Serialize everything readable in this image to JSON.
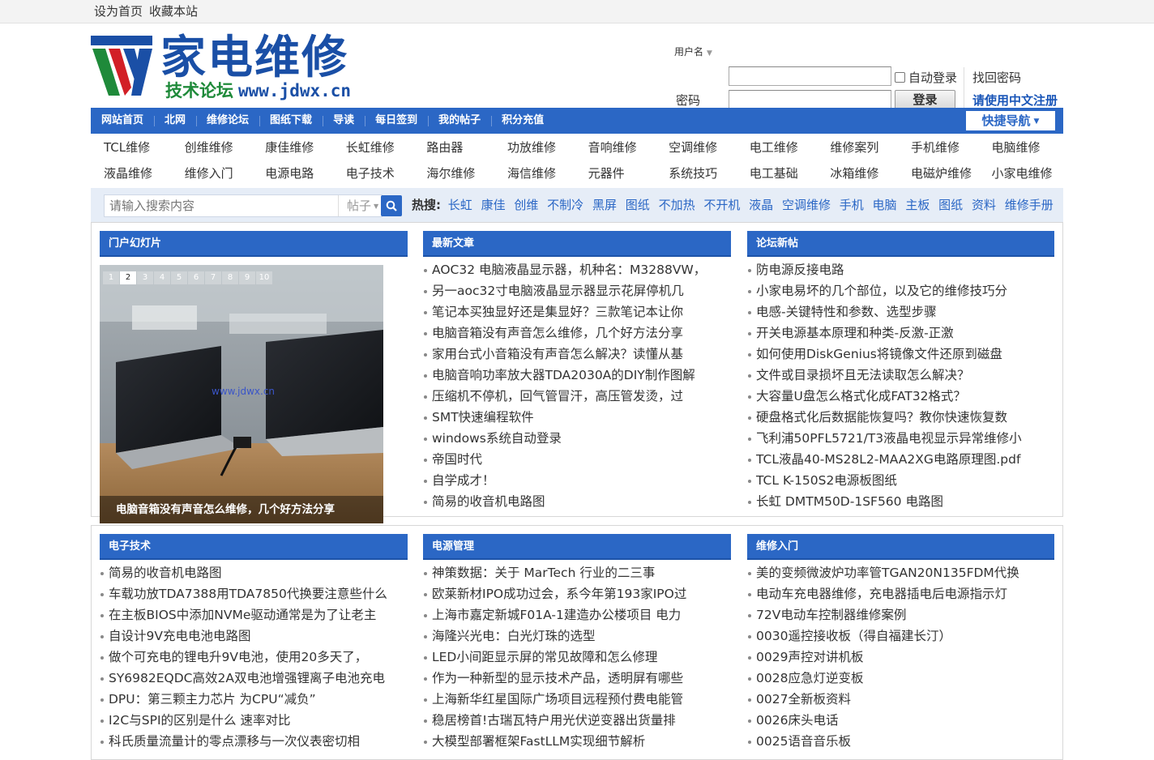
{
  "topbar": {
    "set_home": "设为首页",
    "bookmark": "收藏本站"
  },
  "logo": {
    "title": "家电维修",
    "sub_cn": "技术论坛",
    "sub_url": "www.jdwx.cn"
  },
  "login": {
    "username_label": "用户名",
    "password_label": "密码",
    "auto_login": "自动登录",
    "forgot": "找回密码",
    "login_button": "登录",
    "register": "请使用中文注册"
  },
  "nav": {
    "items": [
      "网站首页",
      "北网",
      "维修论坛",
      "图纸下载",
      "导读",
      "每日签到",
      "我的帖子",
      "积分充值"
    ],
    "quick": "快捷导航"
  },
  "categories": [
    [
      "TCL维修",
      "创维维修",
      "康佳维修",
      "长虹维修",
      "路由器",
      "功放维修",
      "音响维修",
      "空调维修",
      "电工维修",
      "维修案列",
      "手机维修",
      "电脑维修"
    ],
    [
      "液晶维修",
      "维修入门",
      "电源电路",
      "电子技术",
      "海尔维修",
      "海信维修",
      "元器件",
      "系统技巧",
      "电工基础",
      "冰箱维修",
      "电磁炉维修",
      "小家电维修"
    ]
  ],
  "search": {
    "placeholder": "请输入搜索内容",
    "type": "帖子",
    "hot_label": "热搜:",
    "hot": [
      "长虹",
      "康佳",
      "创维",
      "不制冷",
      "黑屏",
      "图纸",
      "不加热",
      "不开机",
      "液晶",
      "空调维修",
      "手机",
      "电脑",
      "主板",
      "图纸",
      "资料",
      "维修手册"
    ]
  },
  "colors": {
    "accent": "#2b67c5",
    "logo_blue": "#1a4fa6",
    "logo_green": "#1f8a3a",
    "logo_red": "#d21f26"
  },
  "portal": {
    "title": "门户幻灯片",
    "pages": [
      "1",
      "2",
      "3",
      "4",
      "5",
      "6",
      "7",
      "8",
      "9",
      "10"
    ],
    "active_page": 2,
    "watermark": "www.jdwx.cn",
    "caption": "电脑音箱没有声音怎么维修，几个好方法分享"
  },
  "latest": {
    "title": "最新文章",
    "items": [
      "AOC32 电脑液晶显示器，机种名：M3288VW，",
      "另一aoc32寸电脑液晶显示器显示花屏停机几",
      "笔记本买独显好还是集显好？三款笔记本让你",
      "电脑音箱没有声音怎么维修，几个好方法分享",
      "家用台式小音箱没有声音怎么解决？读懂从基",
      "电脑音响功率放大器TDA2030A的DIY制作图解",
      "压缩机不停机，回气管冒汗，高压管发烫，过",
      "SMT快速编程软件",
      "windows系统自动登录",
      "帝国时代",
      "自学成才！",
      "简易的收音机电路图"
    ]
  },
  "forum": {
    "title": "论坛新帖",
    "items": [
      "防电源反接电路",
      "小家电易坏的几个部位，以及它的维修技巧分",
      "电感-关键特性和参数、选型步骤",
      "开关电源基本原理和种类-反激-正激",
      "如何使用DiskGenius将镜像文件还原到磁盘",
      "文件或目录损坏且无法读取怎么解决？",
      "大容量U盘怎么格式化成FAT32格式？",
      "硬盘格式化后数据能恢复吗？教你快速恢复数",
      "飞利浦50PFL5721/T3液晶电视显示异常维修小",
      "TCL液晶40-MS28L2-MAA2XG电路原理图.pdf",
      "TCL K-150S2电源板图纸",
      "长虹 DMTM50D-1SF560 电路图"
    ]
  },
  "electronics": {
    "title": "电子技术",
    "items": [
      "简易的收音机电路图",
      "车载功放TDA7388用TDA7850代换要注意些什么",
      "在主板BIOS中添加NVMe驱动通常是为了让老主",
      "自设计9V充电电池电路图",
      "做个可充电的锂电升9V电池，使用20多天了，",
      "SY6982EQDC高效2A双电池增强锂离子电池充电",
      "DPU：第三颗主力芯片 为CPU“减负”",
      "I2C与SPI的区别是什么 速率对比",
      "科氏质量流量计的零点漂移与一次仪表密切相"
    ]
  },
  "power": {
    "title": "电源管理",
    "items": [
      "神策数据：关于 MarTech 行业的二三事",
      "欧莱新材IPO成功过会，系今年第193家IPO过",
      "上海市嘉定新城F01A-1建造办公楼项目 电力",
      "海隆兴光电：白光灯珠的选型",
      "LED小间距显示屏的常见故障和怎么修理",
      "作为一种新型的显示技术产品，透明屏有哪些",
      "上海新华红星国际广场项目远程预付费电能管",
      "稳居榜首!古瑞瓦特户用光伏逆变器出货量排",
      "大模型部署框架FastLLM实现细节解析"
    ]
  },
  "beginner": {
    "title": "维修入门",
    "items": [
      "美的变频微波炉功率管TGAN20N135FDM代换",
      "电动车充电器维修，充电器插电后电源指示灯",
      "72V电动车控制器维修案例",
      "0030遥控接收板（得自福建长汀）",
      "0029声控对讲机板",
      "0028应急灯逆变板",
      "0027全新板资料",
      "0026床头电话",
      "0025语音音乐板"
    ]
  }
}
